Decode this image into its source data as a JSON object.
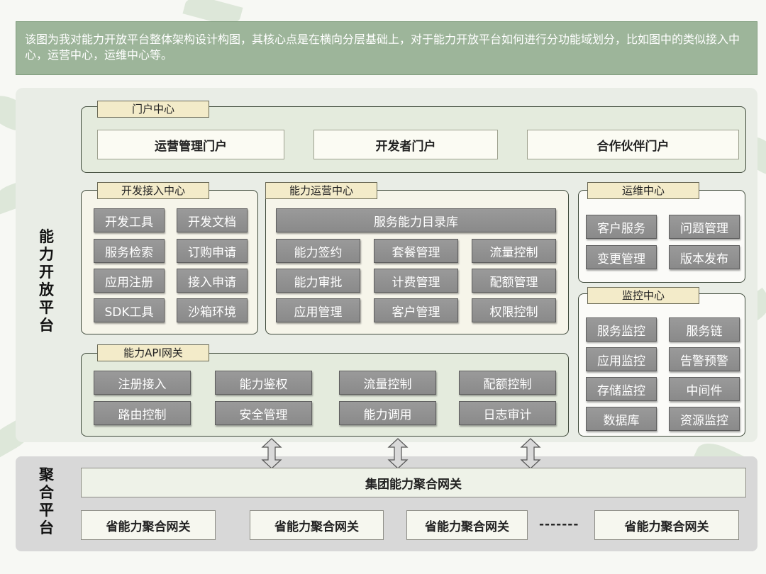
{
  "note": "该图为我对能力开放平台整体架构设计构图，其核心点是在横向分层基础上，对于能力开放平台如何进行分功能域划分，比如图中的类似接入中心，运营中心，运维中心等。",
  "platform_label": [
    "能",
    "力",
    "开",
    "放",
    "平",
    "台"
  ],
  "aggregation_label": [
    "聚",
    "合",
    "平",
    "台"
  ],
  "portal": {
    "tag": "门户中心",
    "items": [
      "运营管理门户",
      "开发者门户",
      "合作伙伴门户"
    ]
  },
  "dev_access": {
    "tag": "开发接入中心",
    "items": [
      "开发工具",
      "开发文档",
      "服务检索",
      "订购申请",
      "应用注册",
      "接入申请",
      "SDK工具",
      "沙箱环境"
    ]
  },
  "ops_center": {
    "tag": "能力运营中心",
    "catalog": "服务能力目录库",
    "items": [
      "能力签约",
      "套餐管理",
      "流量控制",
      "能力审批",
      "计费管理",
      "配额管理",
      "应用管理",
      "客户管理",
      "权限控制"
    ]
  },
  "maint_center": {
    "tag": "运维中心",
    "items": [
      "客户服务",
      "问题管理",
      "变更管理",
      "版本发布"
    ]
  },
  "monitor_center": {
    "tag": "监控中心",
    "items": [
      "服务监控",
      "服务链",
      "应用监控",
      "告警预警",
      "存储监控",
      "中间件",
      "数据库",
      "资源监控"
    ]
  },
  "api_gateway": {
    "tag": "能力API网关",
    "items": [
      "注册接入",
      "能力鉴权",
      "流量控制",
      "配额控制",
      "路由控制",
      "安全管理",
      "能力调用",
      "日志审计"
    ]
  },
  "aggregation": {
    "group_gateway": "集团能力聚合网关",
    "province_gateways": [
      "省能力聚合网关",
      "省能力聚合网关",
      "省能力聚合网关",
      "省能力聚合网关"
    ],
    "ellipsis": "-------"
  }
}
